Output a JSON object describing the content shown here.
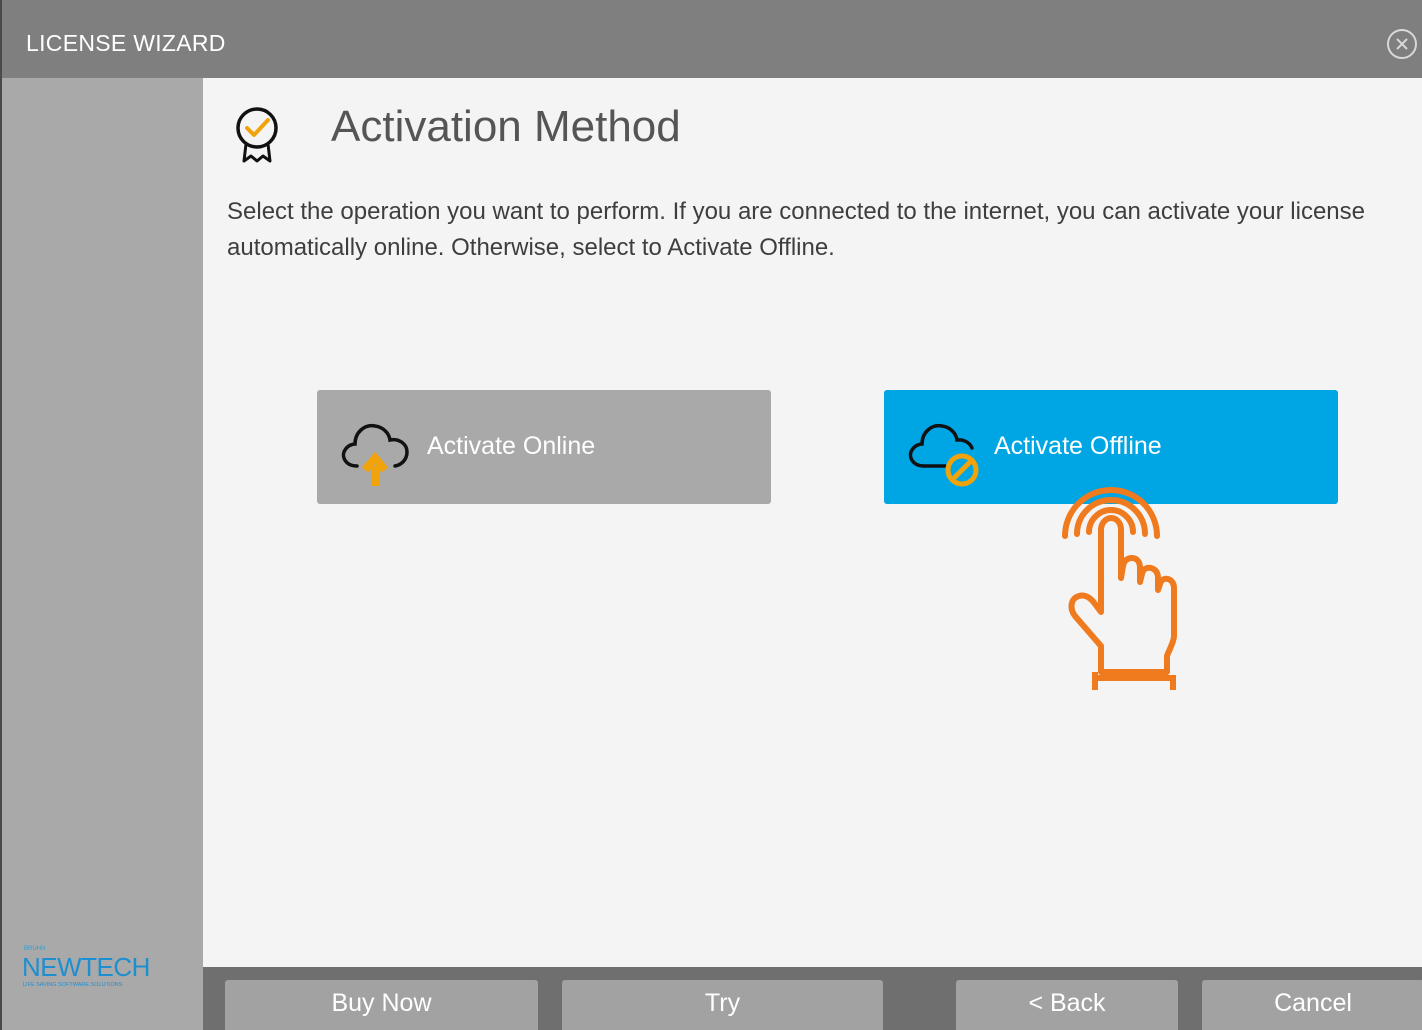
{
  "window": {
    "title": "LICENSE WIZARD",
    "close_icon": "close-circle-icon"
  },
  "page": {
    "icon": "award-badge-check-icon",
    "heading": "Activation Method",
    "description": "Select the operation you want to perform. If you are connected to the internet, you can activate your license automatically online. Otherwise, select to Activate Offline."
  },
  "options": {
    "online": {
      "label": "Activate Online",
      "icon": "cloud-upload-icon",
      "color": "#a9a9a9"
    },
    "offline": {
      "label": "Activate Offline",
      "icon": "cloud-blocked-icon",
      "color": "#00a6e3"
    }
  },
  "footer": {
    "buy_now": "Buy Now",
    "try": "Try",
    "back": "< Back",
    "cancel": "Cancel"
  },
  "brand": {
    "small": "BRUHN",
    "name": "NEWTECH",
    "tagline": "LIFE SAVING SOFTWARE SOLUTIONS"
  },
  "colors": {
    "accent": "#00a6e3",
    "icon_orange": "#f0a30a",
    "hand": "#f07a1e"
  }
}
